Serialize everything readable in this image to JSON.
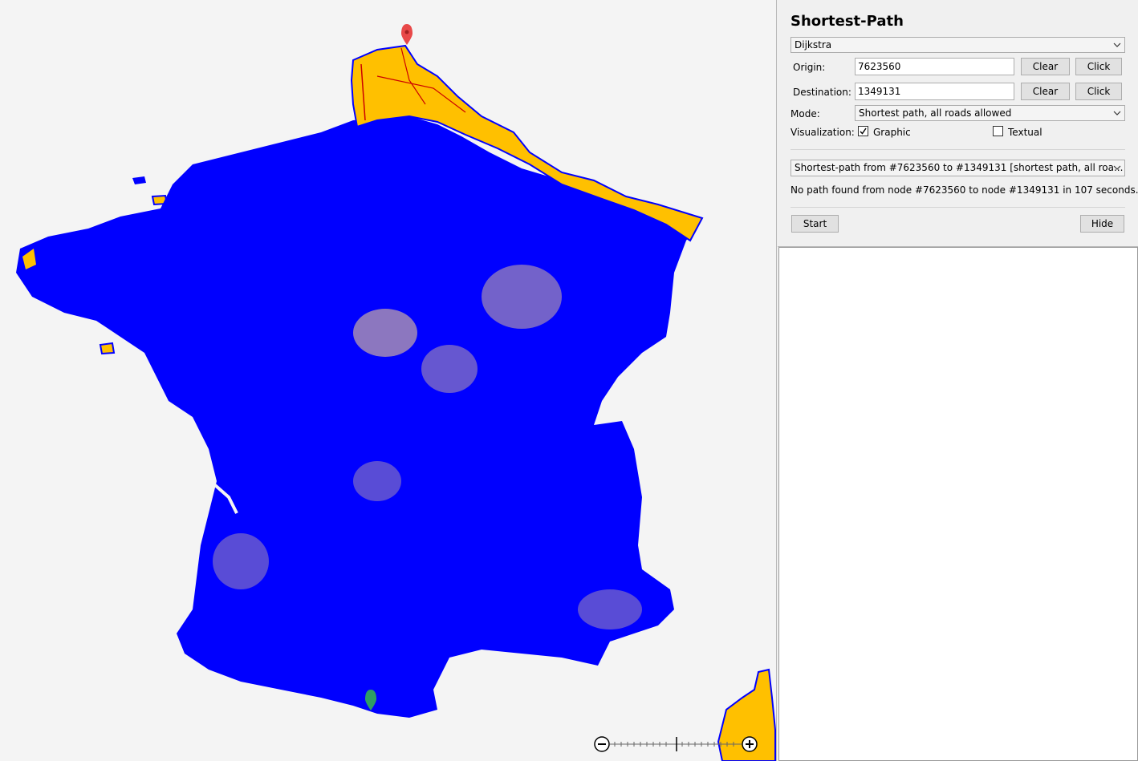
{
  "panel": {
    "title": "Shortest-Path",
    "algorithm": "Dijkstra",
    "origin_label": "Origin:",
    "origin_value": "7623560",
    "destination_label": "Destination:",
    "destination_value": "1349131",
    "clear_label": "Clear",
    "click_label": "Click",
    "mode_label": "Mode:",
    "mode_value": "Shortest path, all roads allowed",
    "visualization_label": "Visualization:",
    "graphic_label": "Graphic",
    "graphic_checked": true,
    "textual_label": "Textual",
    "textual_checked": false,
    "result_selector": "Shortest-path from #7623560 to #1349131 [shortest path, all roa...",
    "status_message": "No path found from node #7623560 to node #1349131 in 107 seconds.",
    "start_label": "Start",
    "hide_label": "Hide"
  },
  "map": {
    "reached_color": "#0000ff",
    "unreached_color": "#ffc000",
    "road_color": "#cc0000",
    "origin_marker_color": "#e84848",
    "destination_marker_color": "#2e9e64",
    "zoom_out_icon": "minus-circle-icon",
    "zoom_in_icon": "plus-circle-icon"
  }
}
